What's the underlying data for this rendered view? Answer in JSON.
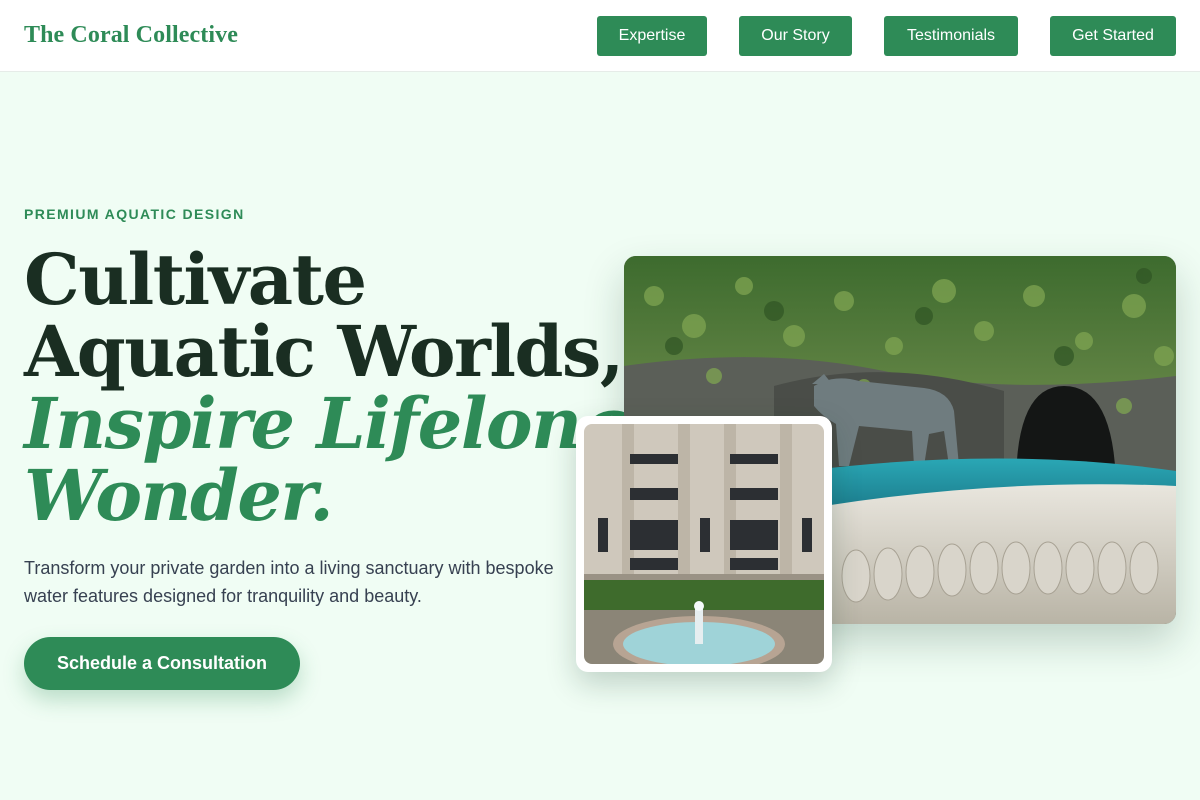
{
  "header": {
    "brand": "The Coral Collective",
    "nav": [
      {
        "label": "Expertise"
      },
      {
        "label": "Our Story"
      },
      {
        "label": "Testimonials"
      },
      {
        "label": "Get Started"
      }
    ]
  },
  "hero": {
    "eyebrow": "PREMIUM AQUATIC DESIGN",
    "headline_line1": "Cultivate",
    "headline_line2": "Aquatic Worlds,",
    "headline_accent1": "Inspire Lifelong",
    "headline_accent2": "Wonder.",
    "description": "Transform your private garden into a living sanctuary with bespoke water features designed for tranquility and beauty.",
    "cta": "Schedule a Consultation"
  },
  "colors": {
    "brand_green": "#2e8b57",
    "page_background": "#f0fdf4",
    "heading_dark": "#1a2e22"
  },
  "images": {
    "main": "ivy-covered grotto fountain with wolf statue",
    "inset": "modernist building courtyard with round fountain"
  }
}
